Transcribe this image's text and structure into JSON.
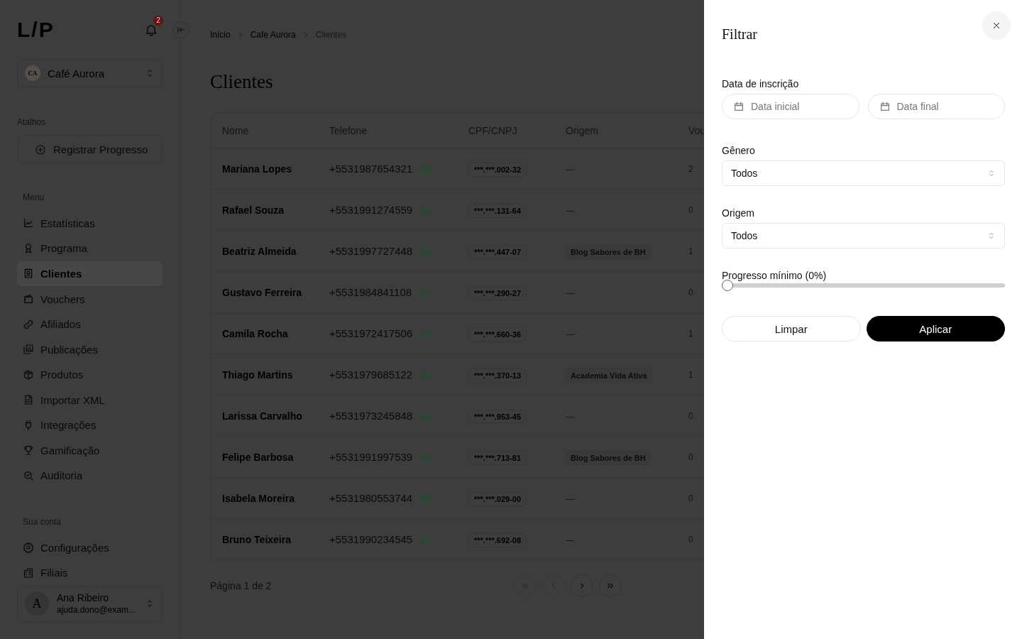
{
  "sidebar": {
    "logo": "L/P",
    "notifications": "2",
    "store": {
      "initials": "CA",
      "name": "Café Aurora"
    },
    "shortcuts": {
      "title": "Atalhos",
      "items": [
        {
          "label": "Registrar Progresso"
        }
      ]
    },
    "menu": {
      "title": "Menu",
      "items": [
        {
          "label": "Estatísticas",
          "selected": false
        },
        {
          "label": "Programa",
          "selected": false
        },
        {
          "label": "Clientes",
          "selected": true
        },
        {
          "label": "Vouchers",
          "selected": false
        },
        {
          "label": "Afiliados",
          "selected": false
        },
        {
          "label": "Publicações",
          "selected": false
        },
        {
          "label": "Produtos",
          "selected": false
        },
        {
          "label": "Importar XML",
          "selected": false
        },
        {
          "label": "Integrações",
          "selected": false
        },
        {
          "label": "Gamificação",
          "selected": false
        },
        {
          "label": "Auditoria",
          "selected": false
        }
      ]
    },
    "account": {
      "title": "Sua conta",
      "items": [
        {
          "label": "Configurações",
          "selected": false
        },
        {
          "label": "Filiais",
          "selected": false
        }
      ]
    },
    "user": {
      "initial": "A",
      "name": "Ana Ribeiro",
      "email": "ajuda.dono@exam..."
    }
  },
  "breadcrumb": [
    "Início",
    "Cafe Aurora",
    "Clientes"
  ],
  "page_title": "Clientes",
  "table": {
    "columns": [
      "Nome",
      "Telefone",
      "CPF/CNPJ",
      "Origem",
      "Vou"
    ],
    "rows": [
      {
        "name": "Mariana Lopes",
        "phone": "+5531987654321",
        "document": "***.***.002-32",
        "origin": "—",
        "origin_tag": false,
        "column_5": "2"
      },
      {
        "name": "Rafael Souza",
        "phone": "+5531991274559",
        "document": "***.***.131-64",
        "origin": "—",
        "origin_tag": false,
        "column_5": "0"
      },
      {
        "name": "Beatriz Almeida",
        "phone": "+5531997727448",
        "document": "***.***.447-07",
        "origin": "Blog Sabores de BH",
        "origin_tag": true,
        "column_5": "1"
      },
      {
        "name": "Gustavo Ferreira",
        "phone": "+5531984841108",
        "document": "***.***.290-27",
        "origin": "—",
        "origin_tag": false,
        "column_5": "0"
      },
      {
        "name": "Camila Rocha",
        "phone": "+5531972417506",
        "document": "***.***.660-36",
        "origin": "—",
        "origin_tag": false,
        "column_5": "1"
      },
      {
        "name": "Thiago Martins",
        "phone": "+5531979685122",
        "document": "***.***.370-13",
        "origin": "Academia Vida Ativa",
        "origin_tag": true,
        "column_5": "1"
      },
      {
        "name": "Larissa Carvalho",
        "phone": "+5531973245848",
        "document": "***.***.953-45",
        "origin": "—",
        "origin_tag": false,
        "column_5": "0"
      },
      {
        "name": "Felipe Barbosa",
        "phone": "+5531991997539",
        "document": "***.***.713-81",
        "origin": "Blog Sabores de BH",
        "origin_tag": true,
        "column_5": "0"
      },
      {
        "name": "Isabela Moreira",
        "phone": "+5531980553744",
        "document": "***.***.029-00",
        "origin": "—",
        "origin_tag": false,
        "column_5": "0"
      },
      {
        "name": "Bruno Teixeira",
        "phone": "+5531990234545",
        "document": "***.***.692-08",
        "origin": "—",
        "origin_tag": false,
        "column_5": "0"
      }
    ]
  },
  "pagination": {
    "label": "Página 1 de 2",
    "buttons": [
      {
        "kind": "first",
        "disabled": true
      },
      {
        "kind": "prev",
        "disabled": true
      },
      {
        "kind": "next",
        "disabled": false
      },
      {
        "kind": "last",
        "disabled": false
      }
    ]
  },
  "filter_panel": {
    "title": "Filtrar",
    "date": {
      "label": "Data de inscrição",
      "start_placeholder": "Data inicial",
      "end_placeholder": "Data final"
    },
    "gender": {
      "label": "Gênero",
      "value": "Todos"
    },
    "origin": {
      "label": "Origem",
      "value": "Todos"
    },
    "progress": {
      "label": "Progresso mínimo (0%)",
      "level": 0
    },
    "buttons": [
      {
        "label": "Limpar",
        "kind": "secondary"
      },
      {
        "label": "Aplicar",
        "kind": "primary"
      }
    ]
  }
}
